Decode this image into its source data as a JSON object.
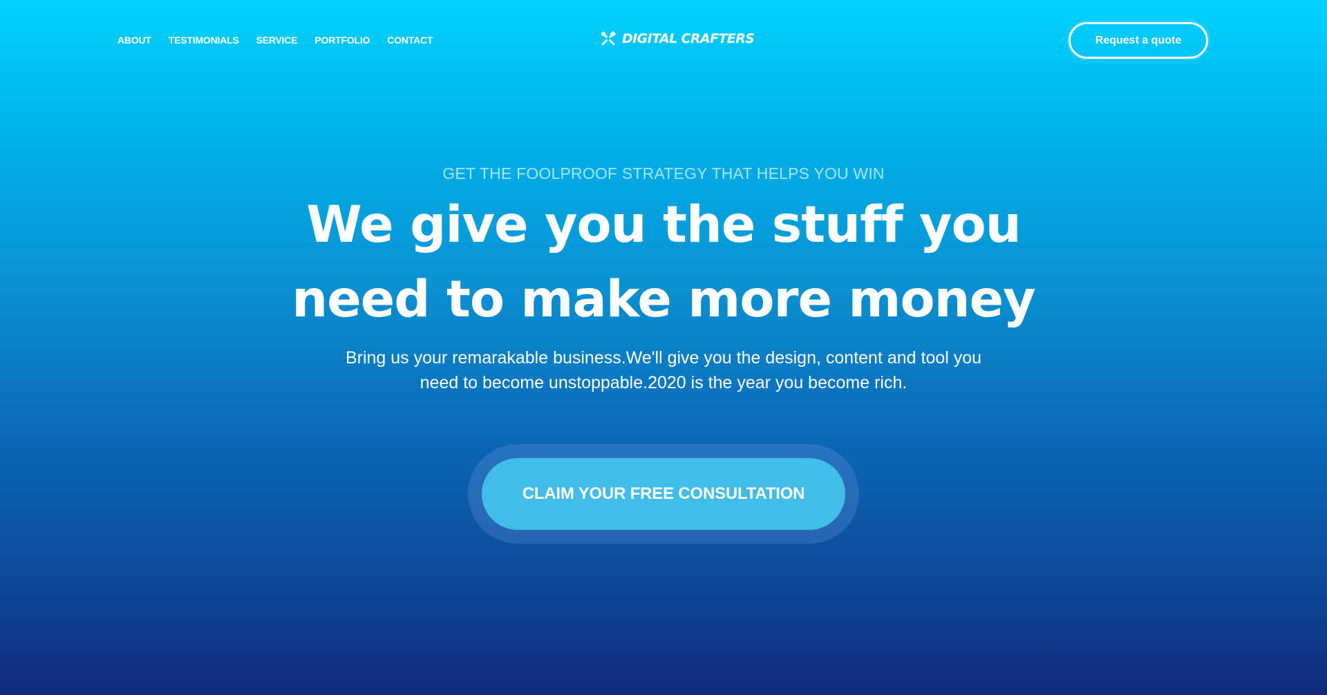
{
  "header": {
    "nav": [
      {
        "label": "ABOUT"
      },
      {
        "label": "TESTIMONIALS"
      },
      {
        "label": "SERVICE"
      },
      {
        "label": "PORTFOLIO"
      },
      {
        "label": "CONTACT"
      }
    ],
    "logo": {
      "icon": "crossed-tools-icon",
      "text": "DIGITAL CRAFTERS"
    },
    "quote_button": "Request a quote"
  },
  "hero": {
    "eyebrow": "GET THE FOOLPROOF STRATEGY THAT HELPS YOU WIN",
    "headline": "We give you the stuff you need to make more money",
    "subtext": "Bring us your remarakable business.We'll give you the design, content and tool you need to become unstoppable.2020 is the year you become rich.",
    "cta": "CLAIM YOUR FREE CONSULTATION"
  },
  "colors": {
    "gradient_top": "#00d2ff",
    "gradient_bottom": "#112a79",
    "cta_bg": "#41bde8",
    "eyebrow": "#a6e7f8"
  }
}
